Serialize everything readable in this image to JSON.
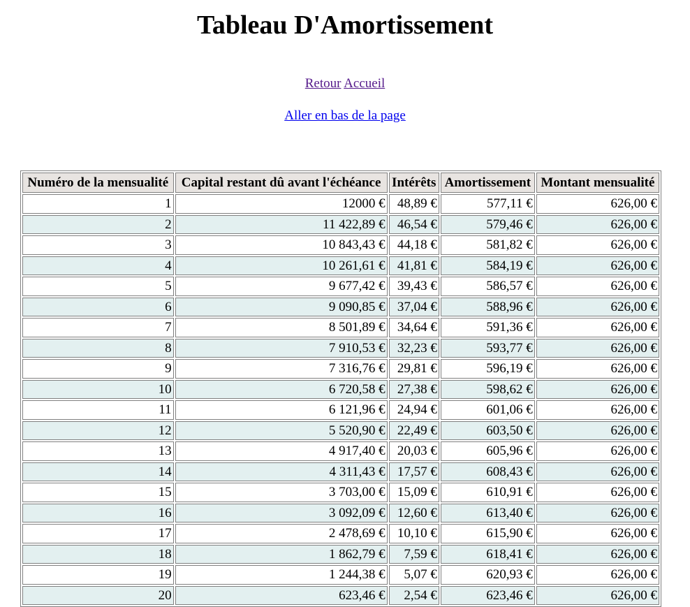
{
  "page": {
    "title": "Tableau D'Amortissement",
    "nav": {
      "retour_label": "Retour",
      "accueil_label": "Accueil",
      "bottom_link_label": "Aller en bas de la page"
    }
  },
  "table": {
    "headers": [
      "Numéro de la mensualité",
      "Capital restant dû avant l'échéance",
      "Intérêts",
      "Amortissement",
      "Montant mensualité"
    ],
    "rows": [
      [
        "1",
        "12000 €",
        "48,89 €",
        "577,11 €",
        "626,00 €"
      ],
      [
        "2",
        "11 422,89 €",
        "46,54 €",
        "579,46 €",
        "626,00 €"
      ],
      [
        "3",
        "10 843,43 €",
        "44,18 €",
        "581,82 €",
        "626,00 €"
      ],
      [
        "4",
        "10 261,61 €",
        "41,81 €",
        "584,19 €",
        "626,00 €"
      ],
      [
        "5",
        "9 677,42 €",
        "39,43 €",
        "586,57 €",
        "626,00 €"
      ],
      [
        "6",
        "9 090,85 €",
        "37,04 €",
        "588,96 €",
        "626,00 €"
      ],
      [
        "7",
        "8 501,89 €",
        "34,64 €",
        "591,36 €",
        "626,00 €"
      ],
      [
        "8",
        "7 910,53 €",
        "32,23 €",
        "593,77 €",
        "626,00 €"
      ],
      [
        "9",
        "7 316,76 €",
        "29,81 €",
        "596,19 €",
        "626,00 €"
      ],
      [
        "10",
        "6 720,58 €",
        "27,38 €",
        "598,62 €",
        "626,00 €"
      ],
      [
        "11",
        "6 121,96 €",
        "24,94 €",
        "601,06 €",
        "626,00 €"
      ],
      [
        "12",
        "5 520,90 €",
        "22,49 €",
        "603,50 €",
        "626,00 €"
      ],
      [
        "13",
        "4 917,40 €",
        "20,03 €",
        "605,96 €",
        "626,00 €"
      ],
      [
        "14",
        "4 311,43 €",
        "17,57 €",
        "608,43 €",
        "626,00 €"
      ],
      [
        "15",
        "3 703,00 €",
        "15,09 €",
        "610,91 €",
        "626,00 €"
      ],
      [
        "16",
        "3 092,09 €",
        "12,60 €",
        "613,40 €",
        "626,00 €"
      ],
      [
        "17",
        "2 478,69 €",
        "10,10 €",
        "615,90 €",
        "626,00 €"
      ],
      [
        "18",
        "1 862,79 €",
        "7,59 €",
        "618,41 €",
        "626,00 €"
      ],
      [
        "19",
        "1 244,38 €",
        "5,07 €",
        "620,93 €",
        "626,00 €"
      ],
      [
        "20",
        "623,46 €",
        "2,54 €",
        "623,46 €",
        "626,00 €"
      ]
    ]
  },
  "colors": {
    "header_bg": "#e8e4e1",
    "row_alt_bg": "#e3f0f0",
    "visited_link": "#551a8b",
    "unvisited_link": "#0000ee"
  }
}
